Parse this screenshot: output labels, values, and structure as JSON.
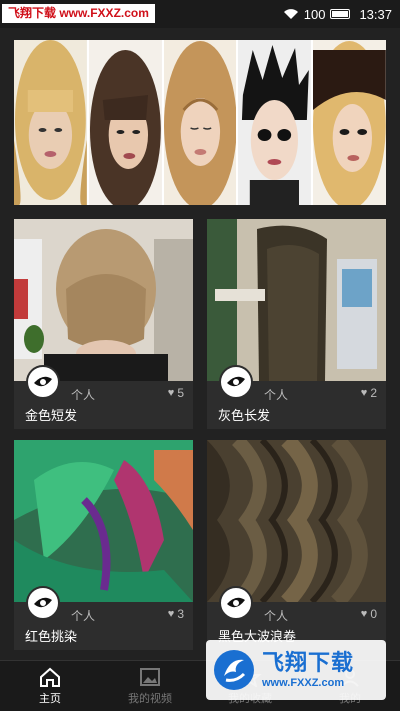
{
  "status_bar": {
    "watermark": "飞翔下载 www.FXXZ.com",
    "battery": "100",
    "time": "13:37"
  },
  "cards": [
    {
      "title": "金色短发",
      "author": "个人",
      "likes": "5"
    },
    {
      "title": "灰色长发",
      "author": "个人",
      "likes": "2"
    },
    {
      "title": "红色挑染",
      "author": "个人",
      "likes": "3"
    },
    {
      "title": "黑色大波浪卷",
      "author": "个人",
      "likes": "0"
    }
  ],
  "bottom_nav": [
    {
      "label": "主页",
      "icon": "home-icon"
    },
    {
      "label": "我的视频",
      "icon": "image-icon"
    },
    {
      "label": "我的收藏",
      "icon": "star-icon"
    },
    {
      "label": "我的"
    }
  ],
  "watermark": {
    "title": "飞翔下载",
    "url": "www.FXXZ.com"
  }
}
